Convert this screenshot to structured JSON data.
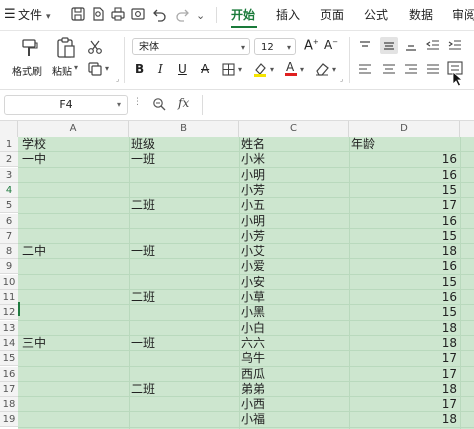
{
  "menubar": {
    "menu_label": "文件",
    "tabs": [
      {
        "label": "开始",
        "active": true
      },
      {
        "label": "插入",
        "active": false
      },
      {
        "label": "页面",
        "active": false
      },
      {
        "label": "公式",
        "active": false
      },
      {
        "label": "数据",
        "active": false
      },
      {
        "label": "审阅",
        "active": false
      }
    ],
    "accent_color": "#1a7a3a"
  },
  "ribbon": {
    "format_painter": "格式刷",
    "paste": "粘贴",
    "font_name": "宋体",
    "font_size": "12"
  },
  "formula_bar": {
    "cell_ref": "F4",
    "fx_label": "fx",
    "value": ""
  },
  "sheet": {
    "columns": [
      "A",
      "B",
      "C",
      "D"
    ],
    "rows": [
      {
        "num": "1",
        "a": "学校",
        "b": "班级",
        "c": "姓名",
        "d": "年龄"
      },
      {
        "num": "2",
        "a": "一中",
        "b": "一班",
        "c": "小米",
        "d": "16"
      },
      {
        "num": "3",
        "a": "",
        "b": "",
        "c": "小明",
        "d": "16"
      },
      {
        "num": "4",
        "a": "",
        "b": "",
        "c": "小芳",
        "d": "15"
      },
      {
        "num": "5",
        "a": "",
        "b": "二班",
        "c": "小五",
        "d": "17"
      },
      {
        "num": "6",
        "a": "",
        "b": "",
        "c": "小明",
        "d": "16"
      },
      {
        "num": "7",
        "a": "",
        "b": "",
        "c": "小芳",
        "d": "15"
      },
      {
        "num": "8",
        "a": "二中",
        "b": "一班",
        "c": "小艾",
        "d": "18"
      },
      {
        "num": "9",
        "a": "",
        "b": "",
        "c": "小爱",
        "d": "16"
      },
      {
        "num": "10",
        "a": "",
        "b": "",
        "c": "小安",
        "d": "15"
      },
      {
        "num": "11",
        "a": "",
        "b": "二班",
        "c": "小草",
        "d": "16"
      },
      {
        "num": "12",
        "a": "",
        "b": "",
        "c": "小黑",
        "d": "15"
      },
      {
        "num": "13",
        "a": "",
        "b": "",
        "c": "小白",
        "d": "18"
      },
      {
        "num": "14",
        "a": "三中",
        "b": "一班",
        "c": "六六",
        "d": "18"
      },
      {
        "num": "15",
        "a": "",
        "b": "",
        "c": "乌牛",
        "d": "17"
      },
      {
        "num": "16",
        "a": "",
        "b": "",
        "c": "西瓜",
        "d": "17"
      },
      {
        "num": "17",
        "a": "",
        "b": "二班",
        "c": "弟弟",
        "d": "18"
      },
      {
        "num": "18",
        "a": "",
        "b": "",
        "c": "小西",
        "d": "17"
      },
      {
        "num": "19",
        "a": "",
        "b": "",
        "c": "小福",
        "d": "18"
      }
    ],
    "cell_fill": "#cde6cf"
  }
}
